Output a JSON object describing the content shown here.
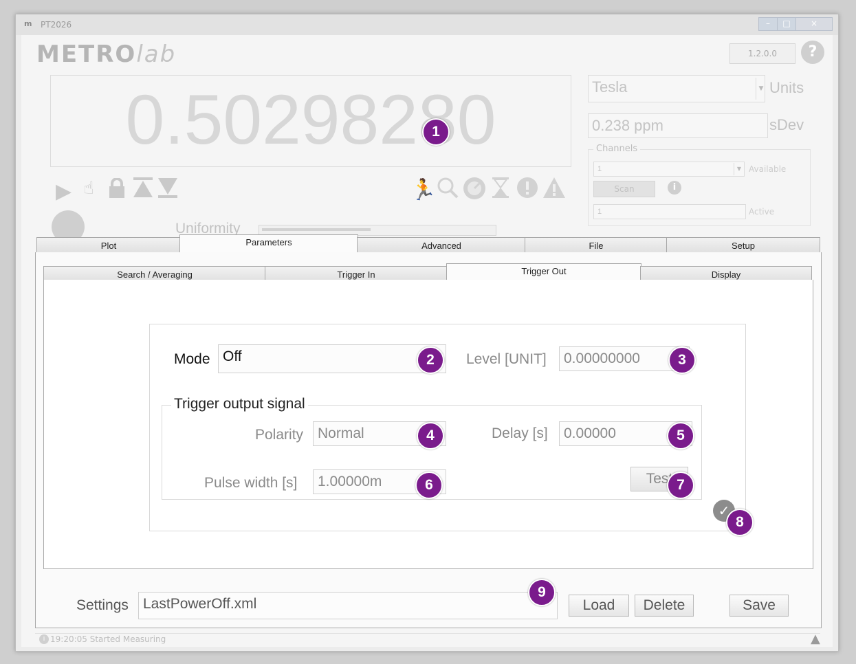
{
  "window": {
    "title": "PT2026",
    "version": "1.2.0.0"
  },
  "logo": {
    "part1": "METRO",
    "part2": "lab"
  },
  "readout": {
    "value": "0.50298280"
  },
  "uniformity": {
    "label": "Uniformity",
    "level": 0.47
  },
  "units": {
    "value": "Tesla",
    "label": "Units"
  },
  "sdev": {
    "value": "0.238 ppm",
    "label": "sDev"
  },
  "channels": {
    "title": "Channels",
    "selected": "1",
    "available_label": "Available",
    "scan_label": "Scan",
    "active_value": "1",
    "active_label": "Active"
  },
  "main_tabs": [
    {
      "label": "Plot"
    },
    {
      "label": "Parameters"
    },
    {
      "label": "Advanced"
    },
    {
      "label": "File"
    },
    {
      "label": "Setup"
    }
  ],
  "sub_tabs": [
    {
      "label": "Search / Averaging"
    },
    {
      "label": "Trigger In"
    },
    {
      "label": "Trigger Out"
    },
    {
      "label": "Display"
    }
  ],
  "trigger_out": {
    "mode_label": "Mode",
    "mode_value": "Off",
    "level_label": "Level [UNIT]",
    "level_value": "0.00000000",
    "signal_title": "Trigger output signal",
    "polarity_label": "Polarity",
    "polarity_value": "Normal",
    "delay_label": "Delay [s]",
    "delay_value": "0.00000",
    "pulse_label": "Pulse width [s]",
    "pulse_value": "1.00000m",
    "test_label": "Test"
  },
  "settings": {
    "label": "Settings",
    "value": "LastPowerOff.xml",
    "load": "Load",
    "delete": "Delete",
    "save": "Save"
  },
  "status": {
    "text": "19:20:05 Started Measuring"
  },
  "badges": [
    "1",
    "2",
    "3",
    "4",
    "5",
    "6",
    "7",
    "8",
    "9"
  ],
  "colors": {
    "badge": "#7a1b8c"
  }
}
